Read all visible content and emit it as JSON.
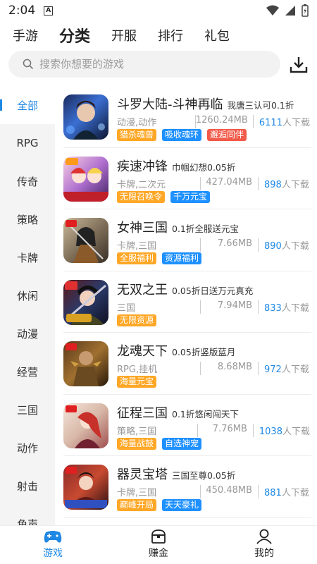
{
  "status": {
    "time": "2:04",
    "app_badge": "A"
  },
  "top_tabs": [
    {
      "label": "手游"
    },
    {
      "label": "分类"
    },
    {
      "label": "开服"
    },
    {
      "label": "排行"
    },
    {
      "label": "礼包"
    }
  ],
  "search": {
    "placeholder": "搜索你想要的游戏"
  },
  "sidebar": [
    {
      "label": "全部"
    },
    {
      "label": "RPG"
    },
    {
      "label": "传奇"
    },
    {
      "label": "策略"
    },
    {
      "label": "卡牌"
    },
    {
      "label": "休闲"
    },
    {
      "label": "动漫"
    },
    {
      "label": "经营"
    },
    {
      "label": "三国"
    },
    {
      "label": "动作"
    },
    {
      "label": "射击"
    },
    {
      "label": "角声"
    }
  ],
  "games": [
    {
      "name": "斗罗大陆-斗神再临",
      "desc": "我唐三认可0.1折",
      "genre": "动漫,动作",
      "size": "1260.24MB",
      "downloads": "6111",
      "dl_suffix": "人下载",
      "tags": [
        {
          "label": "猎杀魂兽",
          "color": "orange"
        },
        {
          "label": "吸收魂环",
          "color": "blue"
        },
        {
          "label": "邂逅同伴",
          "color": "red"
        }
      ]
    },
    {
      "name": "疾速冲锋",
      "desc": "巾帼幻想0.05折",
      "genre": "卡牌,二次元",
      "size": "427.04MB",
      "downloads": "898",
      "dl_suffix": "人下载",
      "tags": [
        {
          "label": "无限召唤令",
          "color": "orange"
        },
        {
          "label": "千万元宝",
          "color": "blue"
        }
      ]
    },
    {
      "name": "女神三国",
      "desc": "0.1折全服送元宝",
      "genre": "卡牌,三国",
      "size": "7.66MB",
      "downloads": "890",
      "dl_suffix": "人下载",
      "tags": [
        {
          "label": "全服福利",
          "color": "orange"
        },
        {
          "label": "资源福利",
          "color": "blue"
        }
      ]
    },
    {
      "name": "无双之王",
      "desc": "0.05折日送万元真充",
      "genre": "三国",
      "size": "7.94MB",
      "downloads": "833",
      "dl_suffix": "人下载",
      "tags": [
        {
          "label": "无限资源",
          "color": "orange"
        }
      ]
    },
    {
      "name": "龙魂天下",
      "desc": "0.05折竖版蓝月",
      "genre": "RPG,挂机",
      "size": "8.68MB",
      "downloads": "972",
      "dl_suffix": "人下载",
      "tags": [
        {
          "label": "海量元宝",
          "color": "orange"
        }
      ]
    },
    {
      "name": "征程三国",
      "desc": "0.1折悠闲闯天下",
      "genre": "策略,三国",
      "size": "7.76MB",
      "downloads": "1038",
      "dl_suffix": "人下载",
      "tags": [
        {
          "label": "海量战鼓",
          "color": "orange"
        },
        {
          "label": "自选神宠",
          "color": "blue"
        }
      ]
    },
    {
      "name": "器灵宝塔",
      "desc": "三国至尊0.05折",
      "genre": "卡牌,三国",
      "size": "450.48MB",
      "downloads": "881",
      "dl_suffix": "人下载",
      "tags": [
        {
          "label": "巅峰开局",
          "color": "orange"
        },
        {
          "label": "天天豪礼",
          "color": "blue"
        }
      ]
    }
  ],
  "bottom_nav": [
    {
      "label": "游戏",
      "icon": "gamepad-icon"
    },
    {
      "label": "赚金",
      "icon": "treasure-chest-icon"
    },
    {
      "label": "我的",
      "icon": "user-icon"
    }
  ],
  "colors": {
    "accent": "#1e88e5",
    "tag_orange": "#ffa726",
    "tag_blue": "#1e90ff",
    "tag_red": "#f25a4a"
  }
}
